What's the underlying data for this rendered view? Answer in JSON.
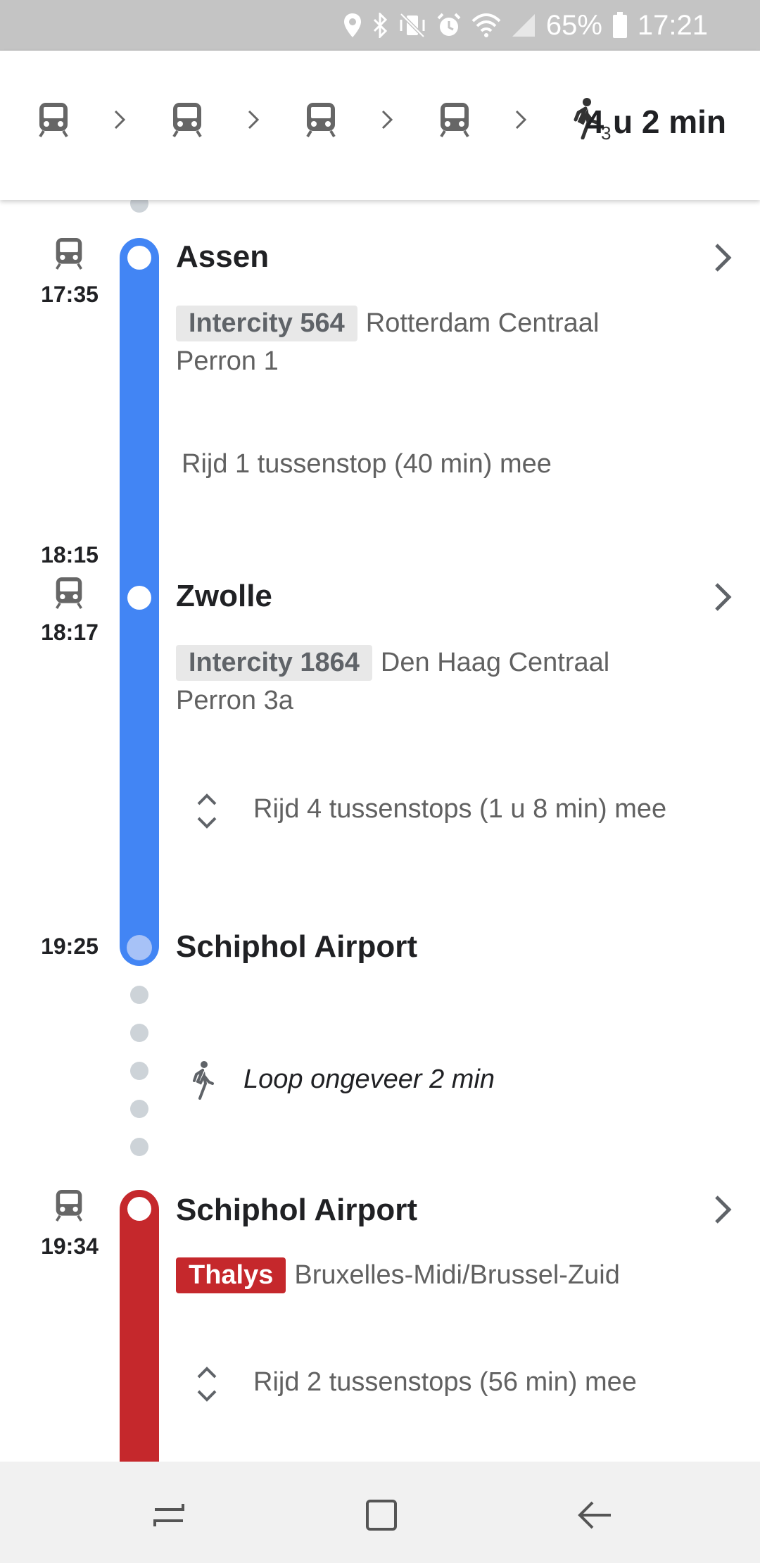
{
  "status_bar": {
    "battery": "65%",
    "time": "17:21"
  },
  "header": {
    "steps": [
      "train-icon",
      "train-icon",
      "train-icon",
      "train-icon",
      "walk-icon"
    ],
    "walk_count": "3",
    "duration": "4 u 2 min"
  },
  "legs": [
    {
      "departure_time": "17:35",
      "station": "Assen",
      "line": "Intercity 564",
      "destination": "Rotterdam Centraal",
      "platform": "Perron 1",
      "ride": "Rijd 1 tussenstop (40 min) mee",
      "color": "#4285f4"
    },
    {
      "arrival_time": "18:15",
      "departure_time": "18:17",
      "station": "Zwolle",
      "line": "Intercity 1864",
      "destination": "Den Haag Centraal",
      "platform": "Perron 3a",
      "ride": "Rijd 4 tussenstops (1 u 8 min) mee",
      "color": "#4285f4"
    }
  ],
  "arrival": {
    "time": "19:25",
    "station": "Schiphol Airport"
  },
  "walk": {
    "text": "Loop ongeveer 2 min"
  },
  "leg3": {
    "departure_time": "19:34",
    "station": "Schiphol Airport",
    "line": "Thalys",
    "destination": "Bruxelles-Midi/Brussel-Zuid",
    "ride": "Rijd 2 tussenstops (56 min) mee",
    "color": "#c5282c"
  },
  "nav": [
    "recent-apps-icon",
    "home-icon",
    "back-icon"
  ]
}
